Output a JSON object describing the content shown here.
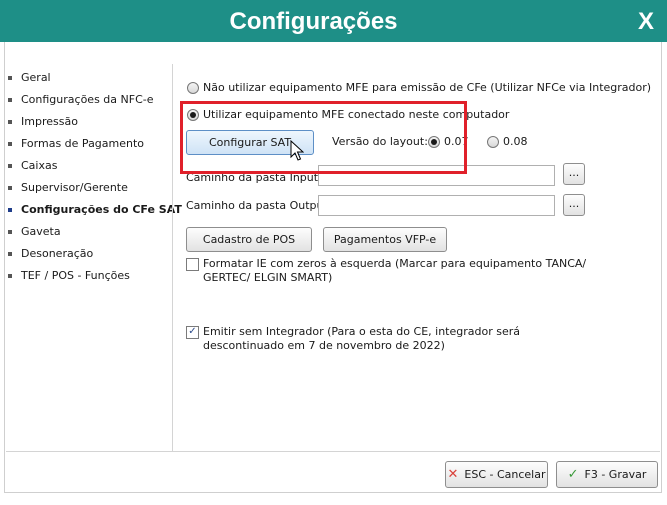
{
  "window": {
    "title": "Configurações",
    "close_label": "X"
  },
  "sidebar": {
    "items": [
      {
        "label": "Geral"
      },
      {
        "label": "Configurações da NFC-e"
      },
      {
        "label": "Impressão"
      },
      {
        "label": "Formas de Pagamento"
      },
      {
        "label": "Caixas"
      },
      {
        "label": "Supervisor/Gerente"
      },
      {
        "label": "Configurações do CFe SAT",
        "active": true
      },
      {
        "label": "Gaveta"
      },
      {
        "label": "Desoneração"
      },
      {
        "label": "TEF / POS - Funções"
      }
    ]
  },
  "main": {
    "radio_no_mfe": {
      "label": "Não utilizar equipamento MFE para emissão de CFe (Utilizar NFCe via Integrador)",
      "checked": false
    },
    "radio_use_mfe": {
      "label": "Utilizar equipamento MFE conectado neste computador",
      "checked": true
    },
    "configure_sat_button": "Configurar SAT",
    "layout_version_label": "Versão do layout:",
    "layout_version_options": [
      {
        "label": "0.07",
        "checked": true
      },
      {
        "label": "0.08",
        "checked": false
      }
    ],
    "input_folder_label": "Caminho da pasta Input:",
    "input_folder_value": "",
    "output_folder_label": "Caminho da pasta Output:",
    "output_folder_value": "",
    "browse_label": "...",
    "pos_register_button": "Cadastro de POS",
    "vfp_payments_button": "Pagamentos VFP-e",
    "format_ie_checkbox": {
      "label": "Formatar IE com zeros à esquerda (Marcar para equipamento TANCA/ GERTEC/ ELGIN SMART)",
      "checked": false
    },
    "emit_without_integrator_checkbox": {
      "label": "Emitir sem Integrador (Para o esta do CE, integrador será descontinuado em  7 de novembro de 2022)",
      "checked": true
    }
  },
  "footer": {
    "cancel_button": "ESC - Cancelar",
    "save_button": "F3 - Gravar"
  },
  "colors": {
    "titlebar": "#1e8f87",
    "highlight": "#e0202a",
    "cancel_icon": "#d9413a",
    "save_icon": "#3a9a3a"
  }
}
